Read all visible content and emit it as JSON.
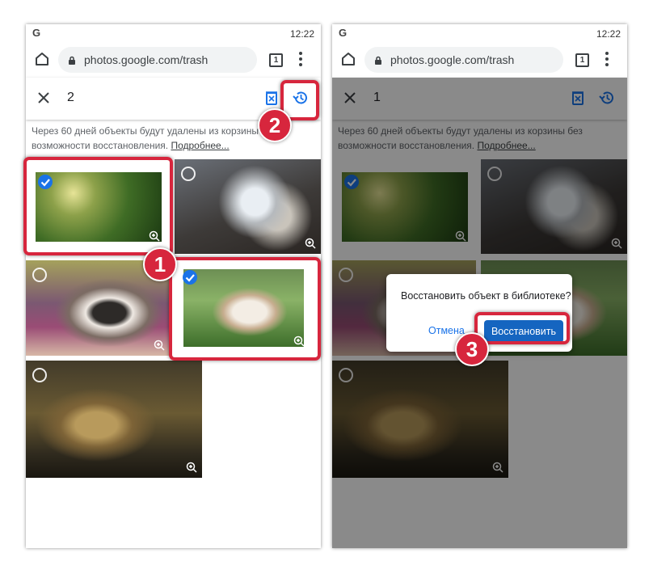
{
  "status_bar": {
    "logo": "G",
    "time": "12:22"
  },
  "browser": {
    "url": "photos.google.com/trash",
    "tab_count": "1"
  },
  "left_screen": {
    "selected_count": "2",
    "notice": "Через 60 дней объекты будут удалены из корзины без возможности восстановления.",
    "notice_link": "Подробнее...",
    "photos": [
      {
        "subject": "leaf-dew",
        "selected": true
      },
      {
        "subject": "dog-in-hat",
        "selected": false
      },
      {
        "subject": "three-dogs",
        "selected": false
      },
      {
        "subject": "hamster",
        "selected": true
      },
      {
        "subject": "monkey",
        "selected": false
      }
    ]
  },
  "right_screen": {
    "selected_count": "1",
    "notice": "Через 60 дней объекты будут удалены из корзины без возможности восстановления.",
    "notice_link": "Подробнее...",
    "dialog": {
      "title": "Восстановить объект в библиотеке?",
      "cancel_label": "Отмена",
      "restore_label": "Восстановить"
    }
  },
  "annotations": {
    "step1": "1",
    "step2": "2",
    "step3": "3"
  },
  "colors": {
    "highlight": "#d7263d",
    "accent": "#1a73e8",
    "restore_button": "#1565c0"
  }
}
